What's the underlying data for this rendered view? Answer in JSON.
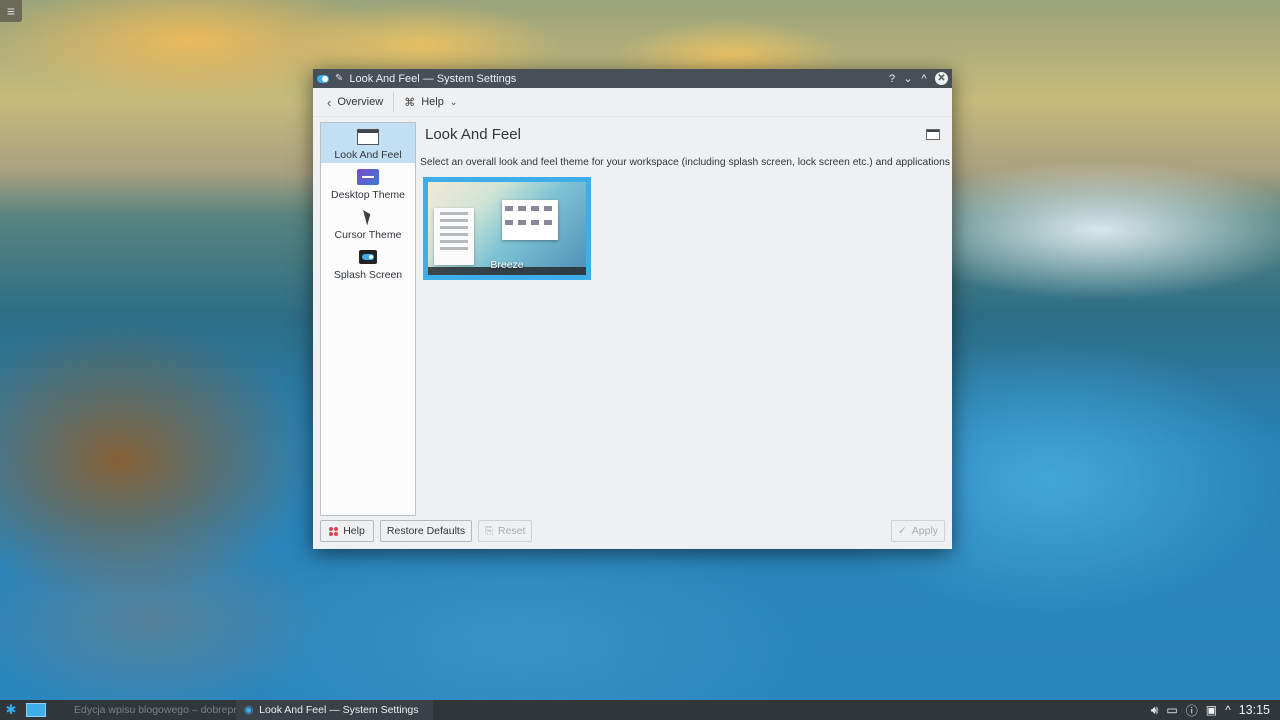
{
  "window": {
    "title": "Look And Feel — System Settings",
    "title_buttons": {
      "help": "?",
      "minimize": "⌄",
      "maximize": "^",
      "close": "✕"
    }
  },
  "toolbar": {
    "overview_label": "Overview",
    "help_label": "Help"
  },
  "sidebar": {
    "items": [
      {
        "label": "Look And Feel",
        "icon": "window-icon",
        "selected": true
      },
      {
        "label": "Desktop Theme",
        "icon": "desktop-theme-icon",
        "selected": false
      },
      {
        "label": "Cursor Theme",
        "icon": "cursor-icon",
        "selected": false
      },
      {
        "label": "Splash Screen",
        "icon": "splash-screen-icon",
        "selected": false
      }
    ]
  },
  "main": {
    "title": "Look And Feel",
    "description": "Select an overall look and feel theme for your workspace (including splash screen, lock screen etc.) and applications",
    "themes": [
      {
        "name": "Breeze",
        "selected": true
      }
    ]
  },
  "buttons": {
    "help": "Help",
    "restore_defaults": "Restore Defaults",
    "reset": "Reset",
    "apply": "Apply"
  },
  "taskbar": {
    "tasks": [
      {
        "label": "Edycja wpisu blogowego – dobreprogramy",
        "active": false
      },
      {
        "label": "Look And Feel — System Settings",
        "active": true
      }
    ],
    "clock": "13:15"
  },
  "colors": {
    "accent": "#3daee9",
    "titlebar": "#475057",
    "window_bg": "#eff0f1",
    "taskbar": "#31363b"
  }
}
